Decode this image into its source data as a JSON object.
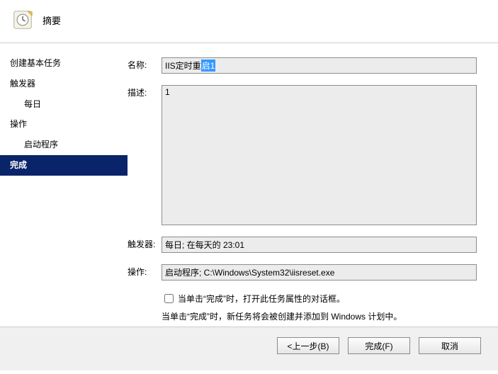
{
  "header": {
    "title": "摘要"
  },
  "sidebar": {
    "items": [
      {
        "label": "创建基本任务",
        "indent": 0,
        "selected": false
      },
      {
        "label": "触发器",
        "indent": 0,
        "selected": false
      },
      {
        "label": "每日",
        "indent": 1,
        "selected": false
      },
      {
        "label": "操作",
        "indent": 0,
        "selected": false
      },
      {
        "label": "启动程序",
        "indent": 1,
        "selected": false
      },
      {
        "label": "完成",
        "indent": 0,
        "selected": true
      }
    ]
  },
  "form": {
    "name_label": "名称:",
    "name_value_prefix": "IIS定时重",
    "name_value_selected": "启1",
    "desc_label": "描述:",
    "desc_value": "1",
    "trigger_label": "触发器:",
    "trigger_value": "每日; 在每天的 23:01",
    "action_label": "操作:",
    "action_value": "启动程序; C:\\Windows\\System32\\iisreset.exe",
    "checkbox_label": "当单击“完成”时，打开此任务属性的对话框。",
    "note": "当单击“完成”时，新任务将会被创建并添加到 Windows 计划中。"
  },
  "buttons": {
    "back": "<上一步(B)",
    "finish": "完成(F)",
    "cancel": "取消"
  }
}
